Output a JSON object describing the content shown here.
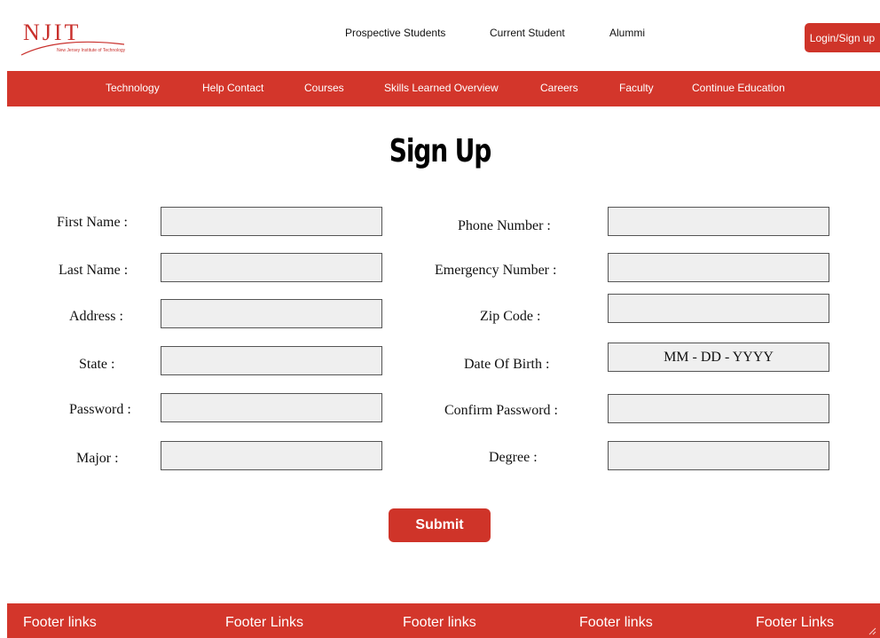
{
  "header": {
    "logo": {
      "letters": "NJIT",
      "subtitle": "New Jersey Institute of Technology"
    },
    "links": [
      "Prospective Students",
      "Current Student",
      "Alummi"
    ],
    "login_label": "Login/Sign up"
  },
  "nav": {
    "items": [
      "Technology",
      "Help Contact",
      "Courses",
      "Skills Learned Overview",
      "Careers",
      "Faculty",
      "Continue Education"
    ]
  },
  "title": "Sign Up",
  "form": {
    "left": [
      {
        "label": "First Name :",
        "value": "",
        "placeholder": ""
      },
      {
        "label": "Last Name :",
        "value": "",
        "placeholder": ""
      },
      {
        "label": "Address :",
        "value": "",
        "placeholder": ""
      },
      {
        "label": "State :",
        "value": "",
        "placeholder": ""
      },
      {
        "label": "Password :",
        "value": "",
        "placeholder": ""
      },
      {
        "label": "Major :",
        "value": "",
        "placeholder": ""
      }
    ],
    "right": [
      {
        "label": "Phone Number :",
        "value": "",
        "placeholder": ""
      },
      {
        "label": "Emergency Number :",
        "value": "",
        "placeholder": ""
      },
      {
        "label": "Zip Code :",
        "value": "",
        "placeholder": ""
      },
      {
        "label": "Date Of Birth :",
        "value": "",
        "placeholder": "MM - DD - YYYY"
      },
      {
        "label": "Confirm Password :",
        "value": "",
        "placeholder": ""
      },
      {
        "label": "Degree :",
        "value": "",
        "placeholder": ""
      }
    ],
    "submit_label": "Submit"
  },
  "footer": {
    "links": [
      "Footer links",
      "Footer Links",
      "Footer links",
      "Footer links",
      "Footer Links"
    ]
  },
  "colors": {
    "brand_red": "#d3362b",
    "field_bg": "#efefef"
  }
}
